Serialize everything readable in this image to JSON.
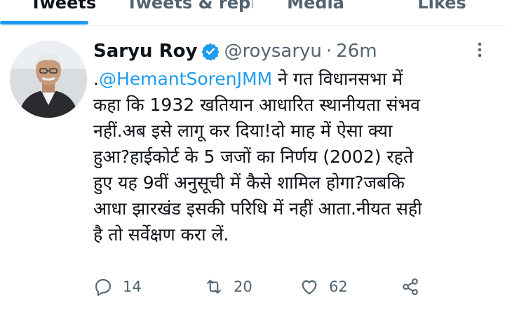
{
  "tabs": [
    "Tweets",
    "Tweets & replies",
    "Media",
    "Likes"
  ],
  "tweet": {
    "author_name": "Saryu Roy",
    "handle": "@roysaryu",
    "separator": "·",
    "time": "26m",
    "text_prefix": ".",
    "mention": "@HemantSorenJMM",
    "text": " ने गत विधानसभा में\nकहा कि 1932 खतियान आधारित स्थानीयता संभव\nनहीं.अब इसे लागू कर दिया!दो माह में ऐसा क्या\nहुआ?हाईकोर्ट के 5 जजों का निर्णय (2002) रहते\nहुए यह 9वीं अनुसूची में कैसे शामिल होगा?जबकि\nआधा झारखंड इसकी परिधि में नहीं आता.नीयत सही\nहै तो सर्वेक्षण करा लें."
  },
  "actions": {
    "reply_count": "14",
    "retweet_count": "20",
    "like_count": "62"
  },
  "icons": [
    "verified-badge-icon",
    "more-options-icon",
    "reply-icon",
    "retweet-icon",
    "like-icon",
    "share-icon"
  ],
  "colors": {
    "accent": "#1d9bf0",
    "secondary_text": "#536471",
    "primary_text": "#0f1419"
  }
}
